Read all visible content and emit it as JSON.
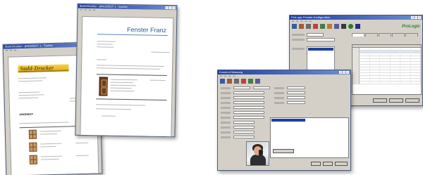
{
  "left_document": {
    "window_title": "Stahl-Drucker - [ANGEBOT 1 - Suche]",
    "logo_text": "Stahl-Drucker",
    "heading": "ANGEBOT"
  },
  "middle_document": {
    "window_title": "Stahl-Drucker - [ANGEBOT 1 - Suche]",
    "company_name": "Fenster Franz"
  },
  "front_app": {
    "window_title": "Kunden-Erfassung"
  },
  "back_app": {
    "window_title": "ProLogic Fenster-Konfiguration",
    "brand": "ProLogic"
  },
  "colors": {
    "titlebar": "#1f3f9f",
    "window_bg": "#d4d0c8",
    "logo_gold": "#e3b41e",
    "brand_green": "#2a8a2a",
    "frame_wood": "#c0773a"
  }
}
